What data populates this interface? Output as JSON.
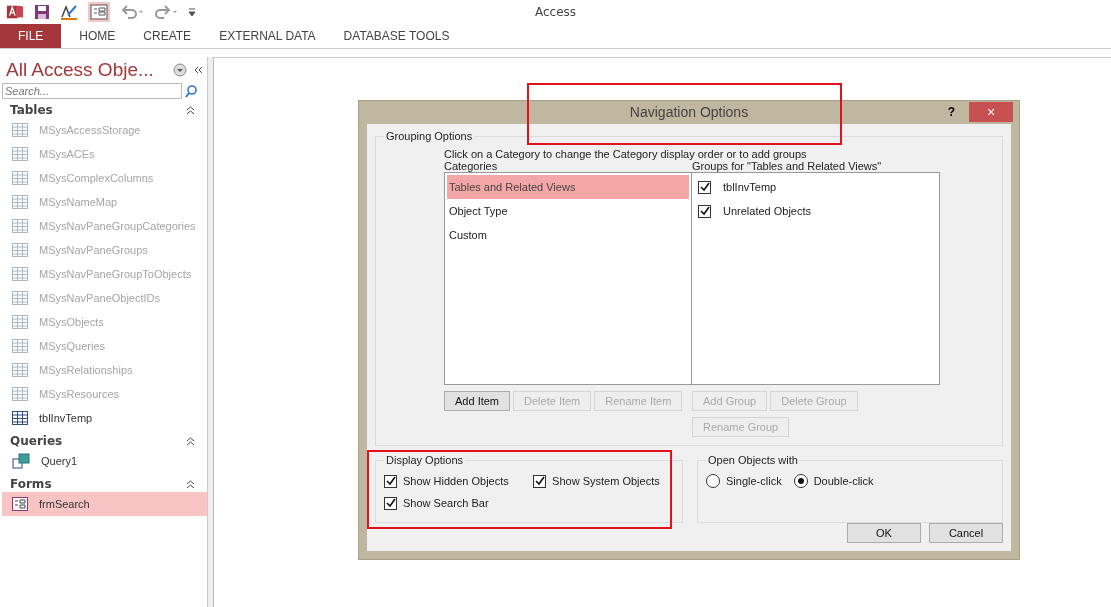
{
  "window": {
    "title": "Access"
  },
  "quick_access": [
    {
      "kind": "app"
    },
    {
      "kind": "save"
    },
    {
      "kind": "design"
    },
    {
      "kind": "form",
      "selected": true
    },
    {
      "kind": "undo"
    },
    {
      "kind": "redo"
    },
    {
      "kind": "customize"
    }
  ],
  "ribbon_tabs": [
    {
      "label": "FILE",
      "kind": "file"
    },
    {
      "label": "HOME",
      "kind": "tab"
    },
    {
      "label": "CREATE",
      "kind": "tab"
    },
    {
      "label": "EXTERNAL DATA",
      "kind": "tab"
    },
    {
      "label": "DATABASE TOOLS",
      "kind": "tab"
    }
  ],
  "nav_pane": {
    "title": "All Access Obje...",
    "search": {
      "placeholder": "Search..."
    },
    "groups": [
      {
        "label": "Tables",
        "items": [
          {
            "label": "MSysAccessStorage",
            "kind": "table",
            "dimmed": true,
            "selected": false
          },
          {
            "label": "MSysACEs",
            "kind": "table",
            "dimmed": true,
            "selected": false
          },
          {
            "label": "MSysComplexColumns",
            "kind": "table",
            "dimmed": true,
            "selected": false
          },
          {
            "label": "MSysNameMap",
            "kind": "table",
            "dimmed": true,
            "selected": false
          },
          {
            "label": "MSysNavPaneGroupCategories",
            "kind": "table",
            "dimmed": true,
            "selected": false
          },
          {
            "label": "MSysNavPaneGroups",
            "kind": "table",
            "dimmed": true,
            "selected": false
          },
          {
            "label": "MSysNavPaneGroupToObjects",
            "kind": "table",
            "dimmed": true,
            "selected": false
          },
          {
            "label": "MSysNavPaneObjectIDs",
            "kind": "table",
            "dimmed": true,
            "selected": false
          },
          {
            "label": "MSysObjects",
            "kind": "table",
            "dimmed": true,
            "selected": false
          },
          {
            "label": "MSysQueries",
            "kind": "table",
            "dimmed": true,
            "selected": false
          },
          {
            "label": "MSysRelationships",
            "kind": "table",
            "dimmed": true,
            "selected": false
          },
          {
            "label": "MSysResources",
            "kind": "table",
            "dimmed": true,
            "selected": false
          },
          {
            "label": "tblInvTemp",
            "kind": "table",
            "dimmed": false,
            "selected": false
          }
        ]
      },
      {
        "label": "Queries",
        "items": [
          {
            "label": "Query1",
            "kind": "query",
            "dimmed": false,
            "selected": false
          }
        ]
      },
      {
        "label": "Forms",
        "items": [
          {
            "label": "frmSearch",
            "kind": "form",
            "dimmed": false,
            "selected": true
          }
        ]
      }
    ]
  },
  "dialog": {
    "title": "Navigation Options",
    "help": "?",
    "close": "×",
    "grouping": {
      "legend": "Grouping Options",
      "hint": "Click on a Category to change the Category display order or to add groups",
      "categories_label": "Categories",
      "groups_label": "Groups for \"Tables and Related Views\"",
      "categories": [
        {
          "label": "Tables and Related Views",
          "selected": true
        },
        {
          "label": "Object Type",
          "selected": false
        },
        {
          "label": "Custom",
          "selected": false
        }
      ],
      "groups": [
        {
          "label": "tblInvTemp",
          "checked": true
        },
        {
          "label": "Unrelated Objects",
          "checked": true
        }
      ],
      "category_buttons": [
        {
          "label": "Add Item",
          "disabled": false
        },
        {
          "label": "Delete Item",
          "disabled": true
        },
        {
          "label": "Rename Item",
          "disabled": true
        }
      ],
      "group_buttons": [
        {
          "label": "Add Group",
          "disabled": true
        },
        {
          "label": "Delete Group",
          "disabled": true
        },
        {
          "label": "Rename Group",
          "disabled": true
        }
      ]
    },
    "display": {
      "legend": "Display Options",
      "options": [
        {
          "label": "Show Hidden Objects",
          "checked": true
        },
        {
          "label": "Show System Objects",
          "checked": true
        },
        {
          "label": "Show Search Bar",
          "checked": true
        }
      ]
    },
    "open_with": {
      "legend": "Open Objects with",
      "options": [
        {
          "label": "Single-click",
          "selected": false
        },
        {
          "label": "Double-click",
          "selected": true
        }
      ]
    },
    "buttons": [
      {
        "label": "OK"
      },
      {
        "label": "Cancel"
      }
    ]
  },
  "highlights": {
    "dialog_title": true,
    "display_options": true
  }
}
